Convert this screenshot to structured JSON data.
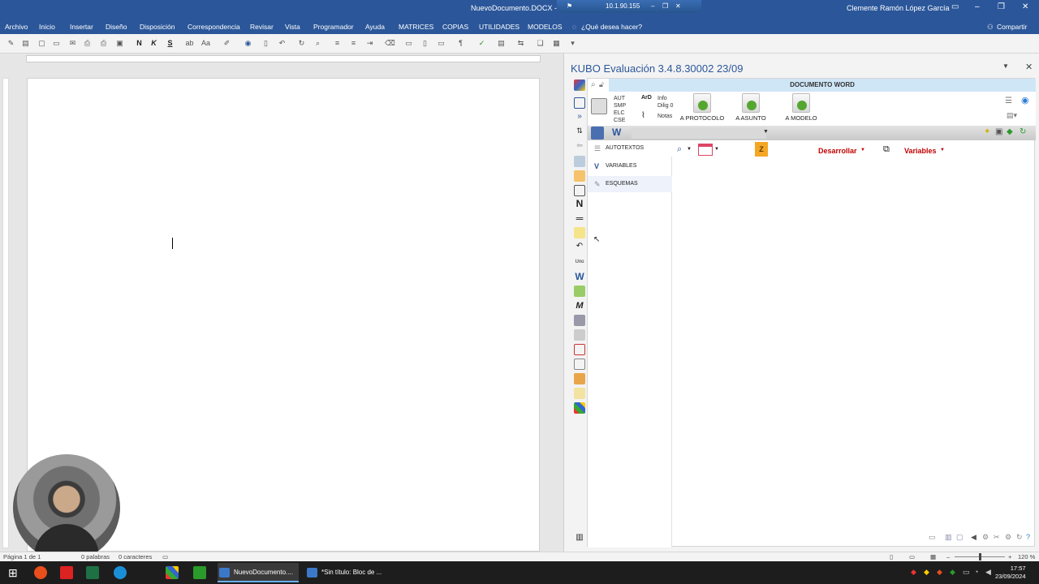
{
  "window": {
    "title": "NuevoDocumento.DOCX - Word",
    "remote_ip": "10.1.90.155",
    "user": "Clemente Ramón López García"
  },
  "menu": {
    "items": [
      "Archivo",
      "Inicio",
      "Insertar",
      "Diseño",
      "Disposición",
      "Correspondencia",
      "Revisar",
      "Vista",
      "Programador",
      "Ayuda",
      "MATRICES",
      "COPIAS",
      "UTILIDADES",
      "MODELOS"
    ],
    "tell_me": "¿Qué desea hacer?",
    "share": "Compartir"
  },
  "toolbar": {
    "bold": "N",
    "italic": "K",
    "underline": "S"
  },
  "kubo": {
    "title": "KUBO Evaluación 3.4.8.30002   23/09",
    "section": "DOCUMENTO WORD",
    "codes": [
      "AUT",
      "SMP",
      "ELC",
      "CSE"
    ],
    "info": [
      "Info",
      "Dilig 0"
    ],
    "notes": "Notas",
    "buttons": {
      "protocolo": "A PROTOCOLO",
      "asunto": "A ASUNTO",
      "modelo": "A MODELO"
    },
    "tree": [
      "AUTOTEXTOS",
      "VARIABLES",
      "ESQUEMAS"
    ],
    "z_label": "Z",
    "desarrollar": "Desarrollar",
    "variables": "Variables",
    "side_letters": {
      "n": "N",
      "w": "W",
      "m": "M",
      "uno": "Uno"
    }
  },
  "status": {
    "page": "Página 1 de 1",
    "words": "0 palabras",
    "chars": "0 caracteres",
    "zoom": "120 %"
  },
  "taskbar": {
    "windows": [
      "NuevoDocumento....",
      "*Sin título: Bloc de ..."
    ],
    "time": "17:57",
    "date": "23/09/2024"
  },
  "colors": {
    "word_blue": "#2b579a",
    "accent_red": "#c00000",
    "z_orange": "#f5a623",
    "section_blue": "#cfe6f7"
  }
}
